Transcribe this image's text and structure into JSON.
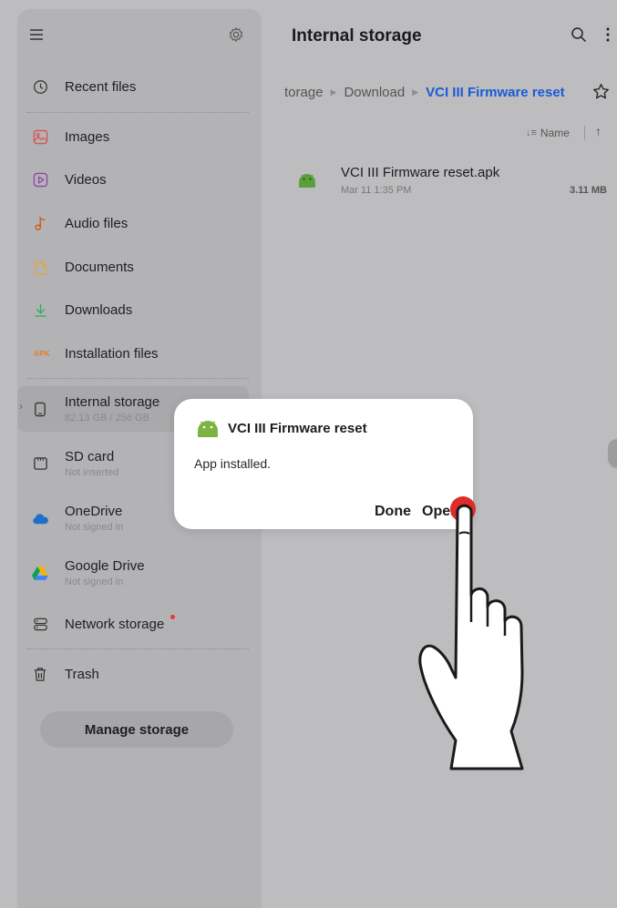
{
  "sidebar": {
    "menu_icon": "hamburger-menu-icon",
    "settings_icon": "gear-icon",
    "items": [
      {
        "label": "Recent files",
        "icon": "clock-icon"
      },
      {
        "label": "Images",
        "icon": "image-icon",
        "color": "#d9534f"
      },
      {
        "label": "Videos",
        "icon": "play-icon",
        "color": "#8e44ad"
      },
      {
        "label": "Audio files",
        "icon": "music-note-icon",
        "color": "#d35400"
      },
      {
        "label": "Documents",
        "icon": "document-icon",
        "color": "#e8a33a"
      },
      {
        "label": "Downloads",
        "icon": "download-icon",
        "color": "#27ae60"
      },
      {
        "label": "Installation files",
        "icon": "apk-icon",
        "badge": "APK",
        "color": "#e67e22"
      }
    ],
    "storage": [
      {
        "label": "Internal storage",
        "sub": "82.13 GB / 256 GB",
        "icon": "phone-icon"
      },
      {
        "label": "SD card",
        "sub": "Not inserted",
        "icon": "sd-card-icon"
      },
      {
        "label": "OneDrive",
        "sub": "Not signed in",
        "icon": "cloud-icon"
      },
      {
        "label": "Google Drive",
        "sub": "Not signed in",
        "icon": "google-drive-icon"
      },
      {
        "label": "Network storage",
        "icon": "network-storage-icon"
      }
    ],
    "trash": {
      "label": "Trash",
      "icon": "trash-icon"
    },
    "manage_storage": "Manage storage"
  },
  "header": {
    "title": "Internal storage",
    "search_icon": "search-icon",
    "more_icon": "more-vertical-icon"
  },
  "breadcrumb": {
    "items": [
      "torage",
      "Download",
      "VCI III Firmware reset"
    ],
    "separator": "▶",
    "star_icon": "star-outline-icon",
    "accent": "#1a5bd6"
  },
  "sort": {
    "label": "Name",
    "icon": "sort-icon",
    "direction_icon": "arrow-up-icon"
  },
  "files": [
    {
      "name": "VCI III Firmware reset.apk",
      "date": "Mar 11 1:35 PM",
      "size": "3.11 MB",
      "icon": "android-icon"
    }
  ],
  "dialog": {
    "app_name": "VCI III Firmware reset",
    "message": "App installed.",
    "done": "Done",
    "open": "Open",
    "icon": "android-icon",
    "android_color": "#7cb342"
  },
  "overlay": {
    "pointer": "hand-pointer-icon",
    "tap_color": "#e02b2b"
  }
}
